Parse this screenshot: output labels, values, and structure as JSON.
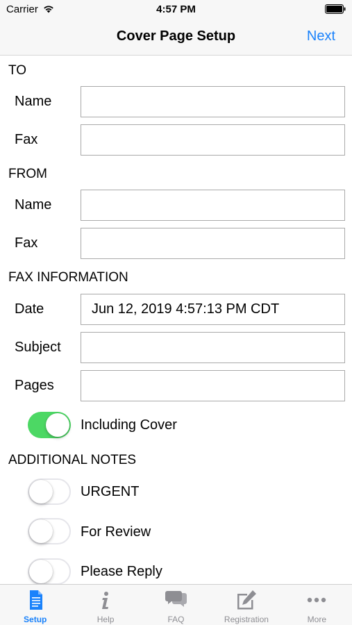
{
  "status_bar": {
    "carrier": "Carrier",
    "time": "4:57 PM"
  },
  "nav": {
    "title": "Cover Page Setup",
    "next_label": "Next"
  },
  "to": {
    "header": "TO",
    "name_label": "Name",
    "name_value": "",
    "fax_label": "Fax",
    "fax_value": ""
  },
  "from": {
    "header": "FROM",
    "name_label": "Name",
    "name_value": "",
    "fax_label": "Fax",
    "fax_value": ""
  },
  "fax_info": {
    "header": "FAX INFORMATION",
    "date_label": "Date",
    "date_value": "Jun 12, 2019 4:57:13 PM CDT",
    "subject_label": "Subject",
    "subject_value": "",
    "pages_label": "Pages",
    "pages_value": "",
    "including_cover_label": "Including Cover",
    "including_cover_on": true
  },
  "notes": {
    "header": "ADDITIONAL NOTES",
    "items": [
      {
        "label": "URGENT",
        "on": false
      },
      {
        "label": "For Review",
        "on": false
      },
      {
        "label": "Please Reply",
        "on": false
      }
    ]
  },
  "tabs": [
    {
      "label": "Setup",
      "icon": "document-icon",
      "active": true
    },
    {
      "label": "Help",
      "icon": "info-icon",
      "active": false
    },
    {
      "label": "FAQ",
      "icon": "chat-bubbles-icon",
      "active": false
    },
    {
      "label": "Registration",
      "icon": "edit-icon",
      "active": false
    },
    {
      "label": "More",
      "icon": "more-icon",
      "active": false
    }
  ],
  "colors": {
    "accent": "#1a82fb",
    "toggle_on": "#4cd864",
    "tab_inactive": "#8e8e93"
  }
}
